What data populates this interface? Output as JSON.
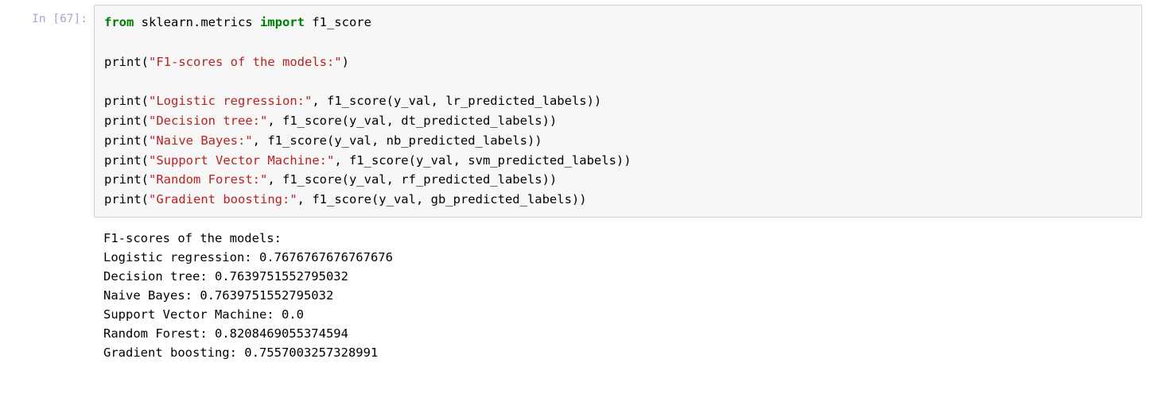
{
  "prompt": {
    "label": "In [",
    "num": "67",
    "suffix": "]:"
  },
  "code": {
    "l1_from": "from",
    "l1_mod": " sklearn.metrics ",
    "l1_import": "import",
    "l1_name": " f1_score",
    "l3_fn": "print",
    "l3_s": "\"F1-scores of the models:\"",
    "l5_fn": "print",
    "l5_s": "\"Logistic regression:\"",
    "l5_r": ", f1_score(y_val, lr_predicted_labels))",
    "l6_fn": "print",
    "l6_s": "\"Decision tree:\"",
    "l6_r": ", f1_score(y_val, dt_predicted_labels))",
    "l7_fn": "print",
    "l7_s": "\"Naive Bayes:\"",
    "l7_r": ", f1_score(y_val, nb_predicted_labels))",
    "l8_fn": "print",
    "l8_s": "\"Support Vector Machine:\"",
    "l8_r": ", f1_score(y_val, svm_predicted_labels))",
    "l9_fn": "print",
    "l9_s": "\"Random Forest:\"",
    "l9_r": ", f1_score(y_val, rf_predicted_labels))",
    "l10_fn": "print",
    "l10_s": "\"Gradient boosting:\"",
    "l10_r": ", f1_score(y_val, gb_predicted_labels))"
  },
  "output": {
    "line1": "F1-scores of the models:",
    "line2": "Logistic regression: 0.7676767676767676",
    "line3": "Decision tree: 0.7639751552795032",
    "line4": "Naive Bayes: 0.7639751552795032",
    "line5": "Support Vector Machine: 0.0",
    "line6": "Random Forest: 0.8208469055374594",
    "line7": "Gradient boosting: 0.7557003257328991"
  }
}
